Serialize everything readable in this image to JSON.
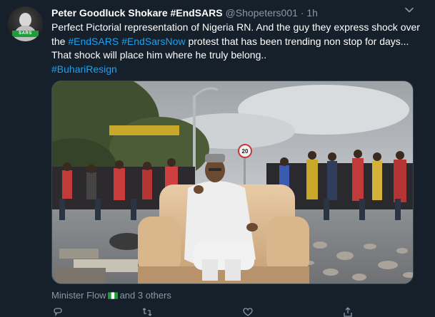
{
  "tweet": {
    "author_name": "Peter Goodluck Shokare #EndSARS",
    "handle": "@Shopeters001",
    "separator": "·",
    "time": "1h",
    "text": {
      "p1": "Perfect Pictorial representation of Nigeria RN. And the guy they express shock over the ",
      "tag1": "#EndSARS",
      "space": " ",
      "tag2": "#EndSarsNow",
      "p2": " protest that has been trending non stop for days... That shock will place him where he truly belong..",
      "tag3": "#BuhariResign"
    },
    "avatar_band": "SARS",
    "media": {
      "sign_speed": "20"
    },
    "likers": {
      "first": "Minister Flow",
      "rest": "and 3 others"
    },
    "icons": {
      "more": "chevron-down-icon",
      "reply": "reply-icon",
      "retweet": "retweet-icon",
      "like": "heart-icon",
      "share": "share-icon"
    },
    "colors": {
      "background": "#15202b",
      "link": "#1da1f2",
      "muted": "#8899a6"
    }
  }
}
